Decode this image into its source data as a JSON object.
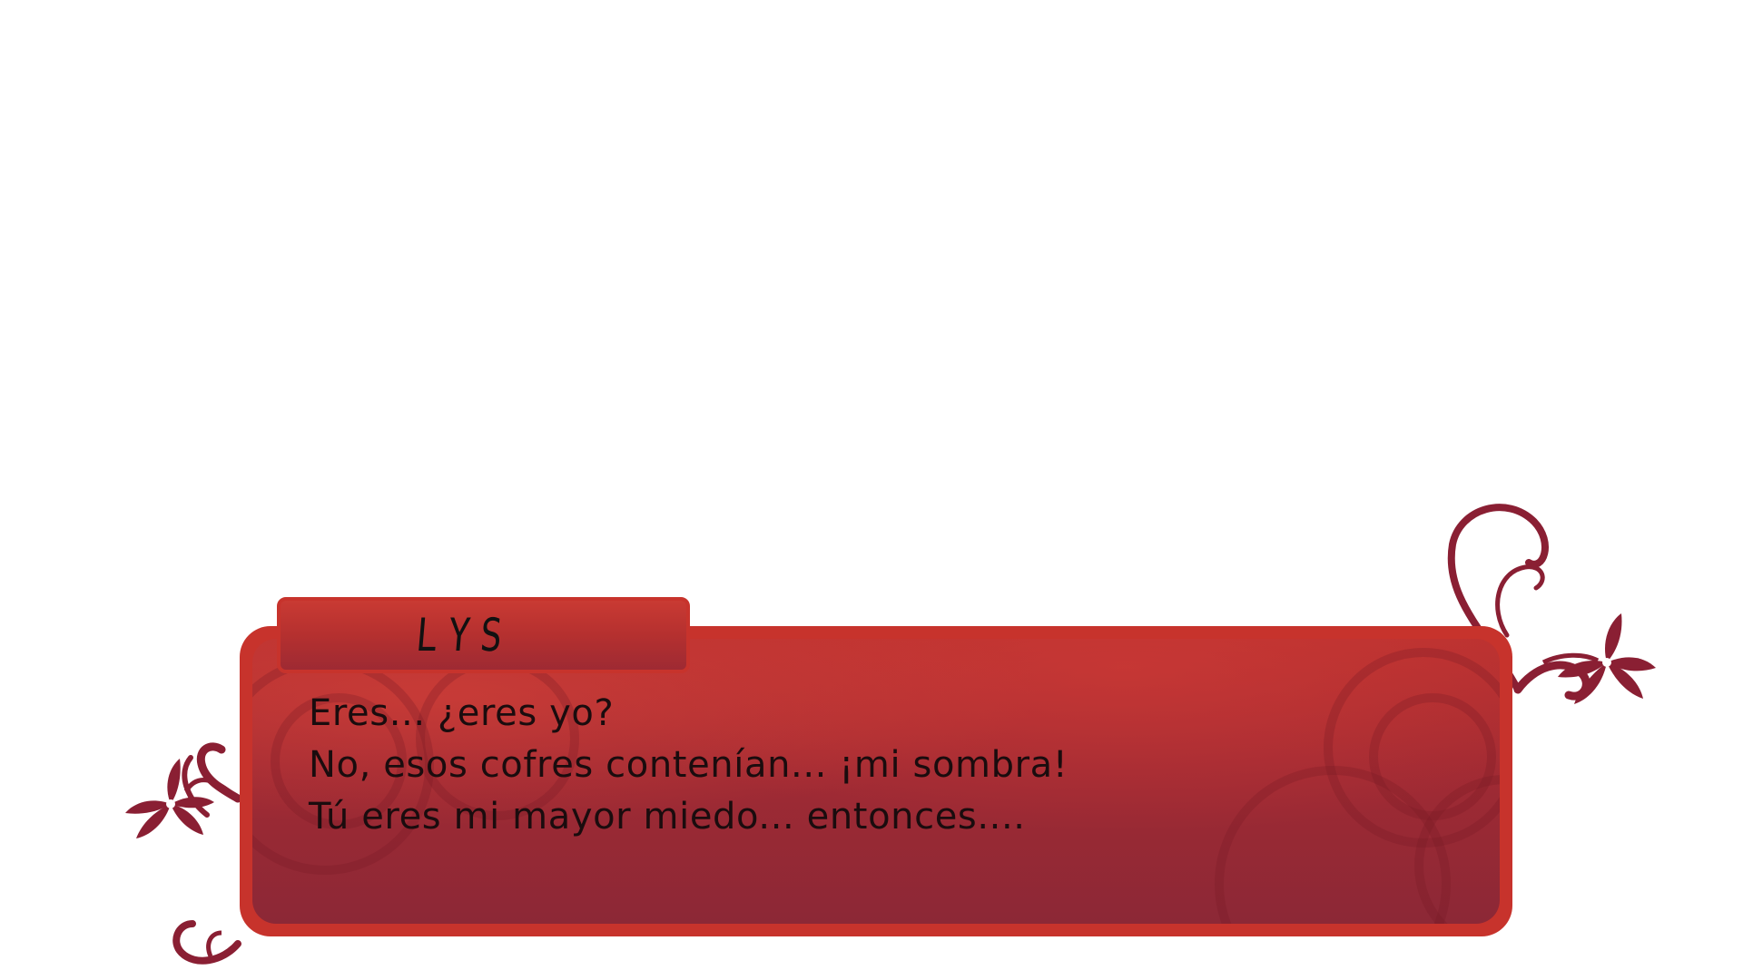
{
  "speaker": {
    "name": "LYS"
  },
  "dialogue": {
    "lines": [
      "Eres... ¿eres yo?",
      "No, esos cofres contenían... ¡mi sombra!",
      "Tú eres mi mayor miedo... entonces...."
    ]
  },
  "theme": {
    "frame_color": "#c7332c",
    "box_color": "#a02a33",
    "ornament_color": "#8a1f33",
    "text_color": "#1a0c0e"
  },
  "icons": {
    "left_ornament": "flower-vine-icon",
    "right_ornament": "flower-vine-icon"
  }
}
